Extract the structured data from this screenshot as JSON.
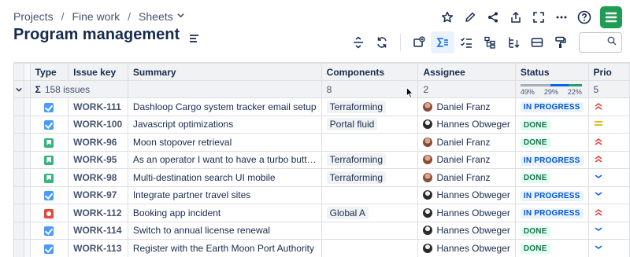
{
  "breadcrumb": {
    "items": [
      "Projects",
      "Fine work",
      "Sheets"
    ],
    "separator": "/"
  },
  "page": {
    "title": "Program management"
  },
  "colors": {
    "accent": "#0c66e4",
    "logo": "#1f9d55",
    "done": "#216e4e",
    "in_progress": "#0055cc",
    "priority_high": "#e2483d",
    "priority_medium": "#e2b203",
    "priority_low": "#0c66e4"
  },
  "top_actions": [
    "star-icon",
    "edit-icon",
    "share-icon",
    "export-icon",
    "fullscreen-icon",
    "more-icon",
    "help-icon",
    "app-logo"
  ],
  "toolbar": [
    "expand-collapse-icon",
    "refresh-icon",
    "add-field-icon",
    "sum-icon",
    "checklist-icon",
    "hierarchy-icon",
    "sort-tree-icon",
    "row-height-icon",
    "format-painter-icon",
    "search-icon"
  ],
  "table": {
    "columns": [
      "Type",
      "Issue key",
      "Summary",
      "Components",
      "Assignee",
      "Status",
      "Prio"
    ],
    "summary": {
      "sigma": "Σ",
      "issues": "158 issues",
      "components": "8",
      "assignee": "2",
      "status_segments": [
        {
          "label": "49%",
          "fraction": 0.49,
          "color": "#a5adba"
        },
        {
          "label": "29%",
          "fraction": 0.29,
          "color": "#0c66e4"
        },
        {
          "label": "22%",
          "fraction": 0.22,
          "color": "#22a06b"
        }
      ],
      "priority": "5"
    },
    "rows": [
      {
        "type": "task",
        "key": "WORK-111",
        "summary": "Dashloop Cargo system tracker email setup",
        "component": "Terraforming",
        "assignee": "Daniel Franz",
        "avatar": "df",
        "status": "IN PROGRESS",
        "status_kind": "progress",
        "priority": "high"
      },
      {
        "type": "task",
        "key": "WORK-100",
        "summary": "Javascript optimizations",
        "component": "Portal fluid",
        "assignee": "Hannes Obweger",
        "avatar": "ho",
        "status": "DONE",
        "status_kind": "done",
        "priority": "med"
      },
      {
        "type": "story",
        "key": "WORK-96",
        "summary": "Moon stopover retrieval",
        "component": "",
        "assignee": "Daniel Franz",
        "avatar": "df",
        "status": "DONE",
        "status_kind": "done",
        "priority": "high"
      },
      {
        "type": "story",
        "key": "WORK-95",
        "summary": "As an operator I want to have a turbo butt…",
        "component": "Terraforming",
        "assignee": "Daniel Franz",
        "avatar": "df",
        "status": "IN PROGRESS",
        "status_kind": "progress",
        "priority": "high"
      },
      {
        "type": "story",
        "key": "WORK-98",
        "summary": "Multi-destination search UI mobile",
        "component": "Terraforming",
        "assignee": "Daniel Franz",
        "avatar": "df",
        "status": "DONE",
        "status_kind": "done",
        "priority": "low"
      },
      {
        "type": "task",
        "key": "WORK-97",
        "summary": "Integrate partner travel sites",
        "component": "",
        "assignee": "Hannes Obweger",
        "avatar": "ho",
        "status": "IN PROGRESS",
        "status_kind": "progress",
        "priority": "low"
      },
      {
        "type": "bug",
        "key": "WORK-112",
        "summary": "Booking app incident",
        "component": "Global A",
        "assignee": "Hannes Obweger",
        "avatar": "ho",
        "status": "IN PROGRESS",
        "status_kind": "progress",
        "priority": "high"
      },
      {
        "type": "task",
        "key": "WORK-114",
        "summary": "Switch to annual license renewal",
        "component": "",
        "assignee": "Hannes Obweger",
        "avatar": "ho",
        "status": "DONE",
        "status_kind": "done",
        "priority": "low"
      },
      {
        "type": "task",
        "key": "WORK-113",
        "summary": "Register with the Earth Moon Port Authority",
        "component": "",
        "assignee": "Hannes Obweger",
        "avatar": "ho",
        "status": "DONE",
        "status_kind": "done",
        "priority": "low"
      }
    ]
  }
}
